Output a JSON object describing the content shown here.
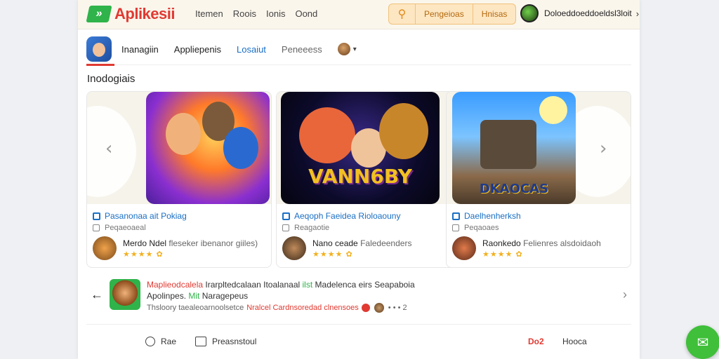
{
  "header": {
    "logo_mark": "»",
    "logo_text": "Aplikesii",
    "nav": [
      "Itemen",
      "Roois",
      "Ionis",
      "Oond"
    ],
    "search_icon": "search-icon",
    "search_buttons": [
      "Pengeioas",
      "Hnisas"
    ],
    "user_name": "Doloeddoeddoeldsl3loit"
  },
  "tabs": {
    "items": [
      "Inanagiin",
      "Appliepenis",
      "Losaiut",
      "Peneeess"
    ]
  },
  "section": {
    "title": "Inodogiais"
  },
  "cards": [
    {
      "title": "Pasanonaa ait Pokiag",
      "subtitle": "Peqaeoaeal",
      "author": "Merdo Ndel",
      "author_extra": "fleseker ibenanor giiles)",
      "rating": "★★★★",
      "badge": "✿"
    },
    {
      "title": "Aeqoph Faeidea Rioloaouny",
      "subtitle": "Reagaotie",
      "author": "Nano ceade",
      "author_extra": "Faledeenders",
      "rating": "★★★★",
      "badge": "✿",
      "logo_word": "VANN6BY"
    },
    {
      "title": "Daelhenherksh",
      "subtitle": "Peqaoaes",
      "author": "Raonkedo",
      "author_extra": "Felienres alsdoidaoh",
      "rating": "★★★★",
      "badge": "✿",
      "logo_word": "DKAOCAS"
    }
  ],
  "activity": {
    "line1_red": "Maplieodcalela",
    "line1_mid": "Irarpltedcalaan Itoalanaal",
    "line1_green": "ilst",
    "line1_end": "Madelenca eirs Seapaboia",
    "line2_start": "Apolinpes.",
    "line2_green": "Mit",
    "line2_end": "Naragepeus",
    "line3_start": "Thsloory taealeoarnoolsetce",
    "line3_red": "Nralcel Cardnsoredad clnensoes",
    "line3_count": "• • • 2"
  },
  "bottom": {
    "reply": "Rae",
    "present": "Preasnstoul",
    "badge": "Do2",
    "more": "Hooca"
  }
}
